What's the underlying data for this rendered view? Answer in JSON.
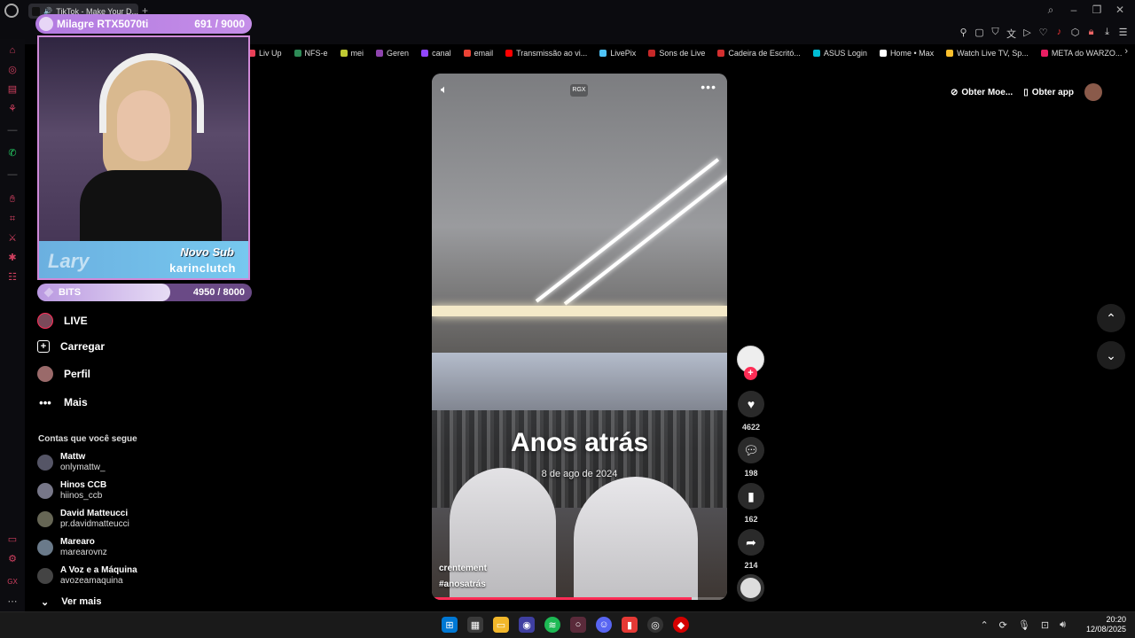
{
  "browser": {
    "tab_title": "TikTok - Make Your D...",
    "bookmarks": [
      {
        "label": "Liv Up",
        "color": "#e94057"
      },
      {
        "label": "NFS-e",
        "color": "#2e8b57"
      },
      {
        "label": "mei",
        "color": "#c0ca33"
      },
      {
        "label": "Geren",
        "color": "#8e44ad"
      },
      {
        "label": "canal",
        "color": "#9146ff"
      },
      {
        "label": "email",
        "color": "#ea4335"
      },
      {
        "label": "Transmissão ao vi...",
        "color": "#ff0000"
      },
      {
        "label": "LivePix",
        "color": "#4fc3f7"
      },
      {
        "label": "Sons de Live",
        "color": "#c62828"
      },
      {
        "label": "Cadeira de Escritó...",
        "color": "#d32f2f"
      },
      {
        "label": "ASUS Login",
        "color": "#00bcd4"
      },
      {
        "label": "Home • Max",
        "color": "#ffffff"
      },
      {
        "label": "Watch Live TV, Sp...",
        "color": "#fbc02d"
      },
      {
        "label": "META do WARZO...",
        "color": "#e91e63"
      }
    ]
  },
  "overlay": {
    "goal_title": "Milagre RTX5070ti",
    "goal_count": "691 / 9000",
    "sub_label": "Novo Sub",
    "sub_name": "karinclutch",
    "sub_logo": "Lary",
    "bits_label": "BITS",
    "bits_count": "4950 / 8000",
    "bits_progress": 0.62
  },
  "nav": {
    "live": "LIVE",
    "upload": "Carregar",
    "profile": "Perfil",
    "more": "Mais"
  },
  "following": {
    "title": "Contas que você segue",
    "accounts": [
      {
        "name": "Mattw",
        "handle": "onlymattw_"
      },
      {
        "name": "Hinos CCB",
        "handle": "hiinos_ccb"
      },
      {
        "name": "David Matteucci",
        "handle": "pr.davidmatteucci"
      },
      {
        "name": "Marearo",
        "handle": "marearovnz"
      },
      {
        "name": "A Voz e a Máquina",
        "handle": "avozeamaquina"
      }
    ],
    "see_more": "Ver mais"
  },
  "video": {
    "badge": "RGX",
    "title": "Anos atrás",
    "date": "8 de ago de 2024",
    "author": "crentement",
    "hashtag": "#anosatrás",
    "progress": 0.88
  },
  "actions": {
    "likes": "4622",
    "comments": "198",
    "saves": "162",
    "shares": "214"
  },
  "top_right": {
    "coins": "Obter Moe...",
    "app": "Obter app"
  },
  "clock": {
    "time": "20:20",
    "date": "12/08/2025"
  }
}
